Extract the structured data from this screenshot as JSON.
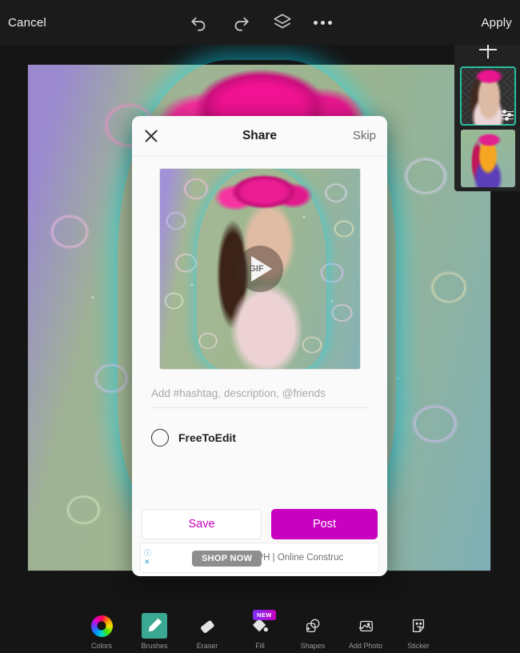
{
  "app": {
    "accent_magenta": "#C800BF",
    "accent_teal": "#3AA892",
    "bar_bg": "#1B1B1B"
  },
  "topbar": {
    "cancel_label": "Cancel",
    "apply_label": "Apply",
    "undo_icon": "undo-icon",
    "redo_icon": "redo-icon",
    "layers_icon": "layers-icon",
    "more_icon": "more-options-icon"
  },
  "layers_panel": {
    "add_label": "+",
    "layers": [
      {
        "name": "layer-1",
        "selected": true
      },
      {
        "name": "layer-2",
        "selected": false
      }
    ]
  },
  "share_modal": {
    "title": "Share",
    "close_icon": "close-icon",
    "skip_label": "Skip",
    "preview": {
      "gif_label": "GIF",
      "play_icon": "play-icon"
    },
    "caption": {
      "value": "",
      "placeholder": "Add #hashtag, description, @friends"
    },
    "freetoedit": {
      "label": "FreeToEdit",
      "checked": false
    },
    "save_label": "Save",
    "post_label": "Post",
    "ad": {
      "info_icon": "info-icon",
      "close_icon": "ad-close-icon",
      "cta_label": "SHOP NOW",
      "text": "YelloPh | Yello PH | Online Construc"
    }
  },
  "toolbar": {
    "tools": [
      {
        "icon": "color-wheel-icon",
        "label": "Colors",
        "selected": false,
        "badge": ""
      },
      {
        "icon": "brush-icon",
        "label": "Brushes",
        "selected": true,
        "badge": ""
      },
      {
        "icon": "eraser-icon",
        "label": "Eraser",
        "selected": false,
        "badge": ""
      },
      {
        "icon": "fill-icon",
        "label": "Fill",
        "selected": false,
        "badge": "NEW"
      },
      {
        "icon": "shape-icon",
        "label": "Shapes",
        "selected": false,
        "badge": ""
      },
      {
        "icon": "add-photo-icon",
        "label": "Add Photo",
        "selected": false,
        "badge": ""
      },
      {
        "icon": "sticker-icon",
        "label": "Sticker",
        "selected": false,
        "badge": ""
      }
    ]
  }
}
